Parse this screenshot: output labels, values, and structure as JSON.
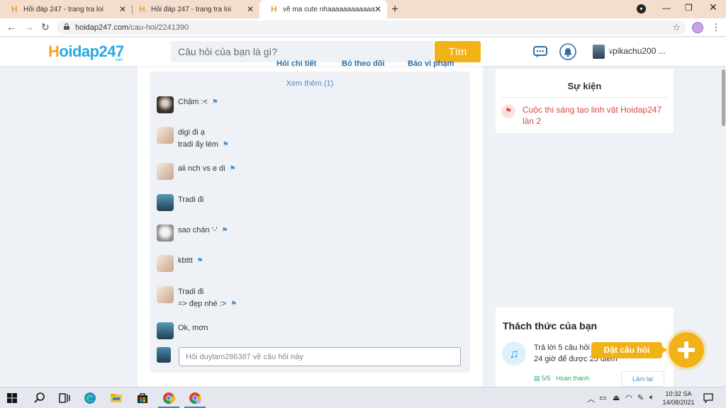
{
  "browser": {
    "tabs": [
      {
        "title": "Hỏi đáp 247 - trang tra loi",
        "active": false
      },
      {
        "title": "Hỏi đáp 247 - trang tra loi",
        "active": false
      },
      {
        "title": "vẽ ma cute nhaaaaaaaaaaaaaaa",
        "active": true
      }
    ],
    "url_host": "hoidap247.com",
    "url_path": "/cau-hoi/2241390"
  },
  "header": {
    "logo_main": "oidap247",
    "logo_h": "H",
    "logo_suffix": ".com",
    "search_placeholder": "Câu hỏi của bạn là gì?",
    "search_button": "Tìm",
    "username": "pikachu200 ..."
  },
  "main": {
    "cut_links": [
      "Hỏi chi tiết",
      "Bỏ theo dõi",
      "Báo vi phạm"
    ],
    "see_more": "Xem thêm (1)",
    "comments": [
      {
        "lines": [
          "Chậm :<"
        ],
        "avatar": "dark"
      },
      {
        "lines": [
          "digi đi ạ",
          "tradi ấy lém"
        ],
        "avatar": "light"
      },
      {
        "lines": [
          "aii nch vs e di"
        ],
        "avatar": "light"
      },
      {
        "lines": [
          "Tradi đi"
        ],
        "avatar": "blue"
      },
      {
        "lines": [
          "sao chán '-'"
        ],
        "avatar": "gray"
      },
      {
        "lines": [
          "kbttt"
        ],
        "avatar": "light"
      },
      {
        "lines": [
          "Tradi đi",
          "=> đẹp nhé :>"
        ],
        "avatar": "light"
      },
      {
        "lines": [
          "Ok, mơn"
        ],
        "avatar": "blue"
      }
    ],
    "reply_placeholder": "Hỏi duylam286387 về câu hỏi này"
  },
  "sidebar": {
    "event_title": "Sự kiện",
    "event_link": "Cuộc thi sáng tạo linh vật Hoidap247 lần 2",
    "challenge_title": "Thách thức của bạn",
    "task": "Trả lời 5 câu hỏi trong 24 giờ để được 25 điểm",
    "progress": "5/5",
    "status": "Hoàn thành",
    "relink": "Làm lại",
    "ask_button": "Đặt câu hỏi"
  },
  "taskbar": {
    "time": "10:32 SA",
    "date": "14/08/2021"
  },
  "colors": {
    "brand_blue": "#27a9e1",
    "brand_yellow": "#f0b216",
    "event_red": "#d64b3f"
  }
}
